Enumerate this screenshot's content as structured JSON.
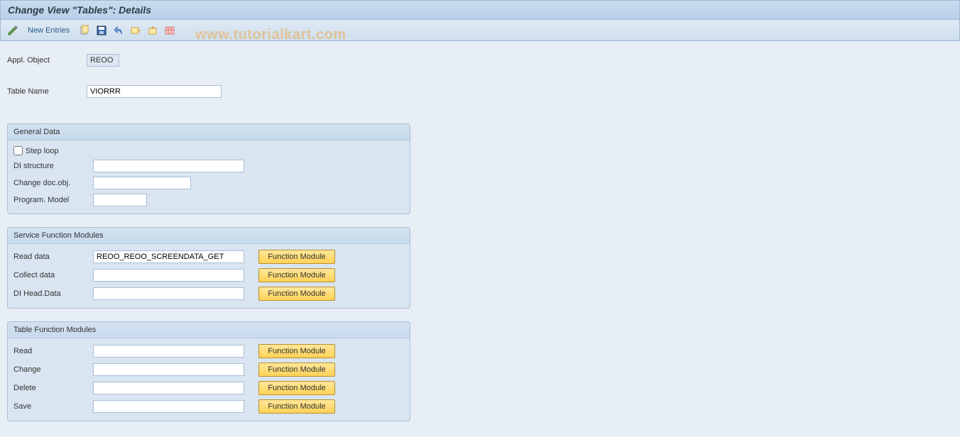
{
  "header": {
    "title": "Change View \"Tables\": Details"
  },
  "toolbar": {
    "new_entries": "New Entries"
  },
  "watermark": "www.tutorialkart.com",
  "basic": {
    "appl_label": "Appl. Object",
    "appl_value": "REOO",
    "table_name_label": "Table Name",
    "table_name_value": "VIORRR"
  },
  "general_data": {
    "title": "General Data",
    "step_loop_label": "Step loop",
    "step_loop_checked": false,
    "di_structure_label": "DI structure",
    "di_structure_value": "",
    "changedoc_label": "Change doc.obj.",
    "changedoc_value": "",
    "progmodel_label": "Program. Model",
    "progmodel_value": ""
  },
  "service_fm": {
    "title": "Service Function Modules",
    "rows": [
      {
        "label": "Read data",
        "value": "REOO_REOO_SCREENDATA_GET",
        "btn": "Function Module"
      },
      {
        "label": "Collect data",
        "value": "",
        "btn": "Function Module"
      },
      {
        "label": "DI Head.Data",
        "value": "",
        "btn": "Function Module"
      }
    ]
  },
  "table_fm": {
    "title": "Table Function Modules",
    "rows": [
      {
        "label": "Read",
        "value": "",
        "btn": "Function Module"
      },
      {
        "label": "Change",
        "value": "",
        "btn": "Function Module"
      },
      {
        "label": "Delete",
        "value": "",
        "btn": "Function Module"
      },
      {
        "label": "Save",
        "value": "",
        "btn": "Function Module"
      }
    ]
  }
}
